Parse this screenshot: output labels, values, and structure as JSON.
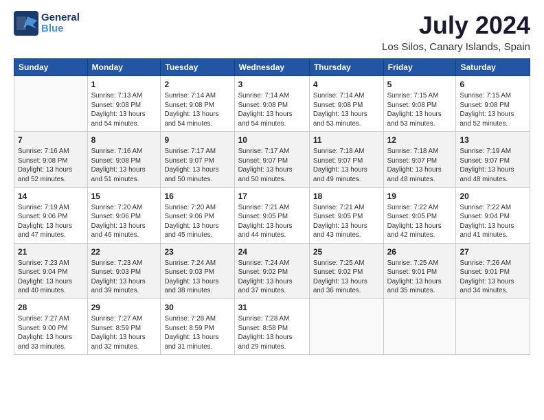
{
  "logo": {
    "line1": "General",
    "line2": "Blue"
  },
  "title": "July 2024",
  "subtitle": "Los Silos, Canary Islands, Spain",
  "days_header": [
    "Sunday",
    "Monday",
    "Tuesday",
    "Wednesday",
    "Thursday",
    "Friday",
    "Saturday"
  ],
  "weeks": [
    [
      {
        "day": "",
        "info": ""
      },
      {
        "day": "1",
        "info": "Sunrise: 7:13 AM\nSunset: 9:08 PM\nDaylight: 13 hours\nand 54 minutes."
      },
      {
        "day": "2",
        "info": "Sunrise: 7:14 AM\nSunset: 9:08 PM\nDaylight: 13 hours\nand 54 minutes."
      },
      {
        "day": "3",
        "info": "Sunrise: 7:14 AM\nSunset: 9:08 PM\nDaylight: 13 hours\nand 54 minutes."
      },
      {
        "day": "4",
        "info": "Sunrise: 7:14 AM\nSunset: 9:08 PM\nDaylight: 13 hours\nand 53 minutes."
      },
      {
        "day": "5",
        "info": "Sunrise: 7:15 AM\nSunset: 9:08 PM\nDaylight: 13 hours\nand 53 minutes."
      },
      {
        "day": "6",
        "info": "Sunrise: 7:15 AM\nSunset: 9:08 PM\nDaylight: 13 hours\nand 52 minutes."
      }
    ],
    [
      {
        "day": "7",
        "info": "Sunrise: 7:16 AM\nSunset: 9:08 PM\nDaylight: 13 hours\nand 52 minutes."
      },
      {
        "day": "8",
        "info": "Sunrise: 7:16 AM\nSunset: 9:08 PM\nDaylight: 13 hours\nand 51 minutes."
      },
      {
        "day": "9",
        "info": "Sunrise: 7:17 AM\nSunset: 9:07 PM\nDaylight: 13 hours\nand 50 minutes."
      },
      {
        "day": "10",
        "info": "Sunrise: 7:17 AM\nSunset: 9:07 PM\nDaylight: 13 hours\nand 50 minutes."
      },
      {
        "day": "11",
        "info": "Sunrise: 7:18 AM\nSunset: 9:07 PM\nDaylight: 13 hours\nand 49 minutes."
      },
      {
        "day": "12",
        "info": "Sunrise: 7:18 AM\nSunset: 9:07 PM\nDaylight: 13 hours\nand 48 minutes."
      },
      {
        "day": "13",
        "info": "Sunrise: 7:19 AM\nSunset: 9:07 PM\nDaylight: 13 hours\nand 48 minutes."
      }
    ],
    [
      {
        "day": "14",
        "info": "Sunrise: 7:19 AM\nSunset: 9:06 PM\nDaylight: 13 hours\nand 47 minutes."
      },
      {
        "day": "15",
        "info": "Sunrise: 7:20 AM\nSunset: 9:06 PM\nDaylight: 13 hours\nand 46 minutes."
      },
      {
        "day": "16",
        "info": "Sunrise: 7:20 AM\nSunset: 9:06 PM\nDaylight: 13 hours\nand 45 minutes."
      },
      {
        "day": "17",
        "info": "Sunrise: 7:21 AM\nSunset: 9:05 PM\nDaylight: 13 hours\nand 44 minutes."
      },
      {
        "day": "18",
        "info": "Sunrise: 7:21 AM\nSunset: 9:05 PM\nDaylight: 13 hours\nand 43 minutes."
      },
      {
        "day": "19",
        "info": "Sunrise: 7:22 AM\nSunset: 9:05 PM\nDaylight: 13 hours\nand 42 minutes."
      },
      {
        "day": "20",
        "info": "Sunrise: 7:22 AM\nSunset: 9:04 PM\nDaylight: 13 hours\nand 41 minutes."
      }
    ],
    [
      {
        "day": "21",
        "info": "Sunrise: 7:23 AM\nSunset: 9:04 PM\nDaylight: 13 hours\nand 40 minutes."
      },
      {
        "day": "22",
        "info": "Sunrise: 7:23 AM\nSunset: 9:03 PM\nDaylight: 13 hours\nand 39 minutes."
      },
      {
        "day": "23",
        "info": "Sunrise: 7:24 AM\nSunset: 9:03 PM\nDaylight: 13 hours\nand 38 minutes."
      },
      {
        "day": "24",
        "info": "Sunrise: 7:24 AM\nSunset: 9:02 PM\nDaylight: 13 hours\nand 37 minutes."
      },
      {
        "day": "25",
        "info": "Sunrise: 7:25 AM\nSunset: 9:02 PM\nDaylight: 13 hours\nand 36 minutes."
      },
      {
        "day": "26",
        "info": "Sunrise: 7:25 AM\nSunset: 9:01 PM\nDaylight: 13 hours\nand 35 minutes."
      },
      {
        "day": "27",
        "info": "Sunrise: 7:26 AM\nSunset: 9:01 PM\nDaylight: 13 hours\nand 34 minutes."
      }
    ],
    [
      {
        "day": "28",
        "info": "Sunrise: 7:27 AM\nSunset: 9:00 PM\nDaylight: 13 hours\nand 33 minutes."
      },
      {
        "day": "29",
        "info": "Sunrise: 7:27 AM\nSunset: 8:59 PM\nDaylight: 13 hours\nand 32 minutes."
      },
      {
        "day": "30",
        "info": "Sunrise: 7:28 AM\nSunset: 8:59 PM\nDaylight: 13 hours\nand 31 minutes."
      },
      {
        "day": "31",
        "info": "Sunrise: 7:28 AM\nSunset: 8:58 PM\nDaylight: 13 hours\nand 29 minutes."
      },
      {
        "day": "",
        "info": ""
      },
      {
        "day": "",
        "info": ""
      },
      {
        "day": "",
        "info": ""
      }
    ]
  ]
}
